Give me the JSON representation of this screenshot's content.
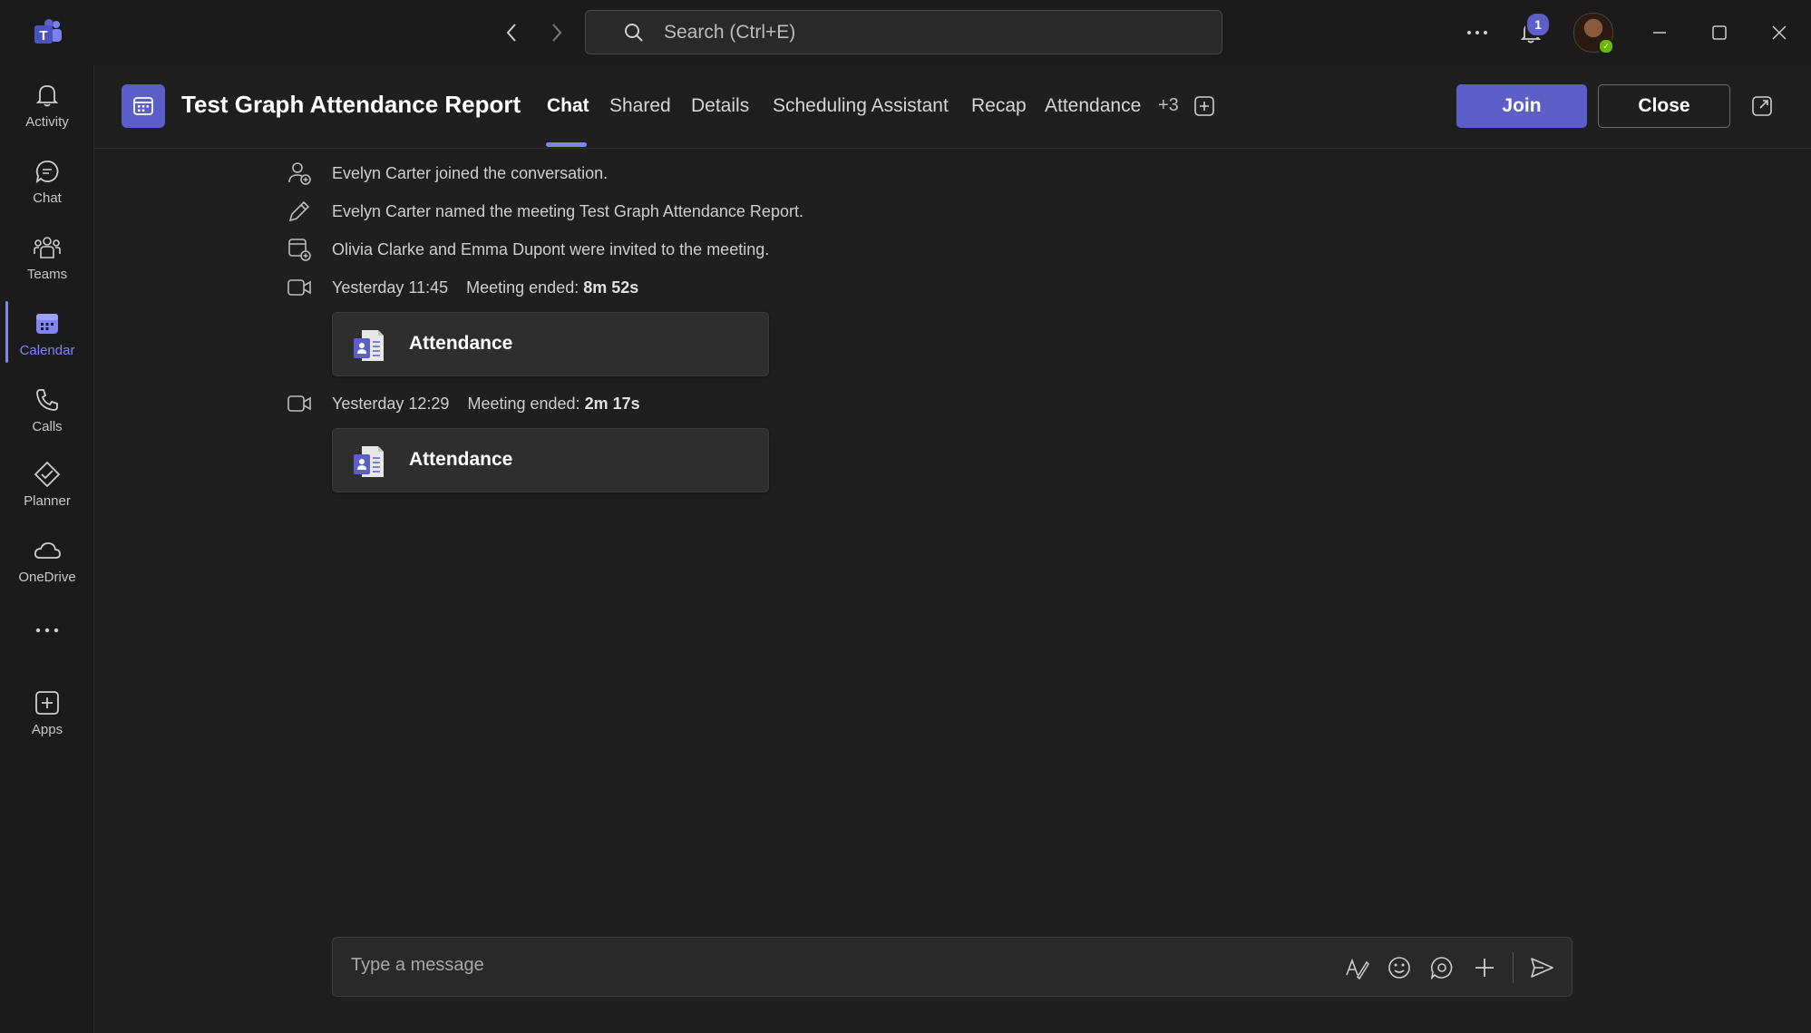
{
  "titlebar": {
    "search_placeholder": "Search (Ctrl+E)",
    "notification_count": "1"
  },
  "rail": {
    "items": [
      {
        "label": "Activity",
        "icon": "bell-icon"
      },
      {
        "label": "Chat",
        "icon": "chat-icon"
      },
      {
        "label": "Teams",
        "icon": "teams-icon"
      },
      {
        "label": "Calendar",
        "icon": "calendar-icon",
        "active": true
      },
      {
        "label": "Calls",
        "icon": "phone-icon"
      },
      {
        "label": "Planner",
        "icon": "planner-icon"
      },
      {
        "label": "OneDrive",
        "icon": "cloud-icon"
      },
      {
        "label": "Apps",
        "icon": "add-app-icon"
      }
    ]
  },
  "header": {
    "title": "Test Graph Attendance Report",
    "tabs": [
      "Chat",
      "Shared",
      "Details",
      "Scheduling Assistant",
      "Recap",
      "Attendance"
    ],
    "active_tab": "Chat",
    "more_tabs": "+3",
    "join_label": "Join",
    "close_label": "Close"
  },
  "messages": [
    {
      "type": "system",
      "icon": "person-add-icon",
      "text": "Evelyn Carter joined the conversation."
    },
    {
      "type": "system",
      "icon": "pencil-icon",
      "text": "Evelyn Carter named the meeting Test Graph Attendance Report."
    },
    {
      "type": "system",
      "icon": "calendar-invite-icon",
      "text": "Olivia Clarke and Emma Dupont were invited to the meeting."
    },
    {
      "type": "meeting",
      "time": "Yesterday 11:45",
      "status": "Meeting ended:",
      "duration": "8m 52s",
      "card_label": "Attendance"
    },
    {
      "type": "meeting",
      "time": "Yesterday 12:29",
      "status": "Meeting ended:",
      "duration": "2m 17s",
      "card_label": "Attendance"
    }
  ],
  "compose": {
    "placeholder": "Type a message"
  },
  "colors": {
    "accent": "#5b5fc7",
    "accent_light": "#7f85f5",
    "background": "#1f1f1f",
    "presence": "#6bb700"
  }
}
